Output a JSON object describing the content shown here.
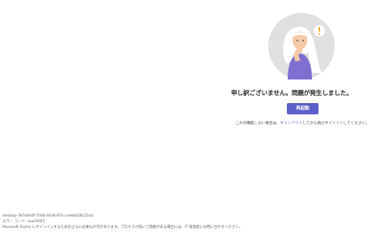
{
  "error_page": {
    "heading": "申し訳ございません。問題が発生しました。",
    "retry_label": "再起動",
    "hint_prefix": "これが機能しない場合は、",
    "hint_link": "サインアウト",
    "hint_suffix": "してから再びサインインしてください。"
  },
  "diagnostics": {
    "session_id": "desktop-3b7a0e0f-70d0-4038-971c-adeb626c52ad",
    "error_code": "エラー コード: caa20001",
    "message": "Microsoft Teams にサインインするためのさらに必要な許可があります。プロセスが続いて問題がある場合には、IT 管理者にお問い合わせください。"
  },
  "colors": {
    "accent": "#5b5fc7",
    "illustration_bg": "#e0e0e0",
    "shirt": "#7f6fd1",
    "alert_badge": "#f2b134"
  },
  "icons": {
    "alert": "exclamation-icon"
  }
}
